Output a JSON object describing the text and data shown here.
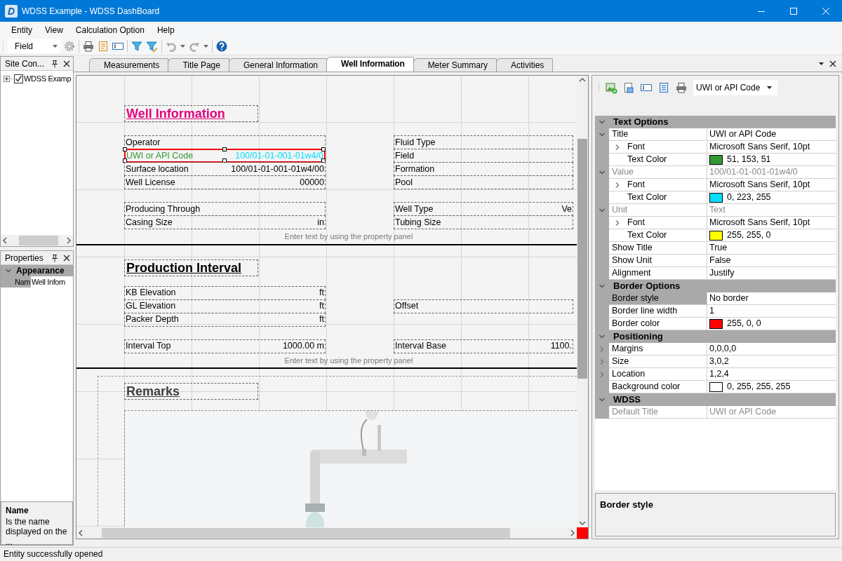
{
  "window": {
    "logo": "D",
    "title": "WDSS Example - WDSS DashBoard"
  },
  "menu": [
    "Entity",
    "View",
    "Calculation Option",
    "Help"
  ],
  "toolbar": {
    "field_select": "Field"
  },
  "site_panel": {
    "title": "Site Con...",
    "tree": [
      {
        "label": "WDSS Examp",
        "checked": true,
        "expanded": false
      }
    ]
  },
  "properties_panel": {
    "title": "Properties",
    "categories": [
      {
        "name": "Appearance",
        "expanded": true,
        "rows": [
          {
            "label": "Nam",
            "value": "Well Infom"
          }
        ]
      }
    ],
    "description": {
      "title": "Name",
      "text": "Is the name displayed on the ..."
    }
  },
  "document_tabs": [
    {
      "label": "Measurements",
      "selected": false
    },
    {
      "label": "Title Page",
      "selected": false
    },
    {
      "label": "General Information",
      "selected": false
    },
    {
      "label": "Well Information",
      "selected": true
    },
    {
      "label": "Meter Summary",
      "selected": false
    },
    {
      "label": "Activities",
      "selected": false
    }
  ],
  "designer": {
    "sections": [
      {
        "kind": "fields",
        "title": "Well Information",
        "color": "#e6007e",
        "groups": [
          {
            "rows": [
              {
                "left": {
                  "label": "Operator",
                  "selected": false
                },
                "right": {
                  "label": "Fluid Type",
                  "selected": false
                }
              },
              {
                "left": {
                  "label": "UWI or API Code",
                  "value": "100/01-01-001-01w4/0",
                  "selected": true
                },
                "right": {
                  "label": "Field",
                  "selected": false
                }
              },
              {
                "left": {
                  "label": "Surface location",
                  "value": "100/01-01-001-01w4/00",
                  "selected": false
                },
                "right": {
                  "label": "Formation",
                  "selected": false
                }
              },
              {
                "left": {
                  "label": "Well License",
                  "value": "00000",
                  "selected": false
                },
                "right": {
                  "label": "Pool",
                  "selected": false
                }
              }
            ]
          },
          {
            "rows": [
              {
                "left": {
                  "label": "Producing Through",
                  "selected": false
                },
                "right": {
                  "label": "Well Type",
                  "value": "Ve",
                  "selected": false
                }
              },
              {
                "left": {
                  "label": "Casing Size",
                  "value": "in",
                  "selected": false
                },
                "right": {
                  "label": "Tubing Size",
                  "selected": false
                }
              }
            ]
          }
        ],
        "hint": "Enter text by using the property panel"
      },
      {
        "kind": "fields",
        "title": "Production Interval",
        "color": "#000000",
        "groups": [
          {
            "rows": [
              {
                "left": {
                  "label": "KB Elevation",
                  "value": "ft",
                  "selected": false
                }
              },
              {
                "left": {
                  "label": "GL Elevation",
                  "value": "ft",
                  "selected": false
                },
                "right": {
                  "label": "Offset",
                  "selected": false
                }
              },
              {
                "left": {
                  "label": "Packer Depth",
                  "value": "ft",
                  "selected": false
                }
              }
            ]
          },
          {
            "rows": [
              {
                "left": {
                  "label": "Interval Top",
                  "value": "1000.00 m",
                  "selected": false
                },
                "right": {
                  "label": "Interval Base",
                  "value": "1100.",
                  "selected": false
                }
              }
            ]
          }
        ],
        "hint": "Enter text by using the property panel"
      },
      {
        "kind": "remarks",
        "title": "Remarks",
        "color": "#404040"
      }
    ]
  },
  "property_grid": {
    "object_select": "UWI or API Code",
    "categories": [
      {
        "name": "Text Options",
        "expanded": true,
        "rows": [
          {
            "label": "Title",
            "value": "UWI or API Code",
            "expanded": true,
            "selected": false,
            "disabled": false,
            "children": [
              {
                "label": "Font",
                "value": "Microsoft Sans Serif, 10pt",
                "expanded": false,
                "selected": false,
                "disabled": false
              },
              {
                "label": "Text Color",
                "value": "51, 153, 51",
                "color": "#339933",
                "selected": false,
                "disabled": false
              }
            ]
          },
          {
            "label": "Value",
            "value": "100/01-01-001-01w4/0",
            "expanded": true,
            "selected": false,
            "disabled": true,
            "children": [
              {
                "label": "Font",
                "value": "Microsoft Sans Serif, 10pt",
                "expanded": false,
                "selected": false,
                "disabled": false
              },
              {
                "label": "Text Color",
                "value": "0, 223, 255",
                "color": "#00dfff",
                "selected": false,
                "disabled": false
              }
            ]
          },
          {
            "label": "Unit",
            "value": "Text",
            "expanded": true,
            "selected": false,
            "disabled": true,
            "children": [
              {
                "label": "Font",
                "value": "Microsoft Sans Serif, 10pt",
                "expanded": false,
                "selected": false,
                "disabled": false
              },
              {
                "label": "Text Color",
                "value": "255, 255, 0",
                "color": "#ffff00",
                "selected": false,
                "disabled": false
              }
            ]
          },
          {
            "label": "Show Title",
            "value": "True",
            "selected": false,
            "disabled": false
          },
          {
            "label": "Show Unit",
            "value": "False",
            "selected": false,
            "disabled": false
          },
          {
            "label": "Alignment",
            "value": "Justify",
            "selected": false,
            "disabled": false
          }
        ]
      },
      {
        "name": "Border Options",
        "expanded": true,
        "rows": [
          {
            "label": "Border style",
            "value": "No border",
            "selected": true,
            "disabled": false
          },
          {
            "label": "Border line width",
            "value": "1",
            "selected": false,
            "disabled": false
          },
          {
            "label": "Border color",
            "value": "255, 0, 0",
            "color": "#ff0000",
            "selected": false,
            "disabled": false
          }
        ]
      },
      {
        "name": "Positioning",
        "expanded": true,
        "rows": [
          {
            "label": "Margins",
            "value": "0,0,0,0",
            "expanded": false,
            "selected": false,
            "disabled": false
          },
          {
            "label": "Size",
            "value": "3,0,2",
            "expanded": false,
            "selected": false,
            "disabled": false
          },
          {
            "label": "Location",
            "value": "1,2,4",
            "expanded": false,
            "selected": false,
            "disabled": false
          },
          {
            "label": "Background color",
            "value": "0, 255, 255, 255",
            "color": "#ffffff",
            "selected": false,
            "disabled": false
          }
        ]
      },
      {
        "name": "WDSS",
        "expanded": true,
        "rows": [
          {
            "label": "Default Title",
            "value": "UWI or API Code",
            "selected": false,
            "disabled": true
          }
        ]
      }
    ],
    "description": {
      "title": "Border style"
    }
  },
  "status_bar": "Entity successfully opened"
}
